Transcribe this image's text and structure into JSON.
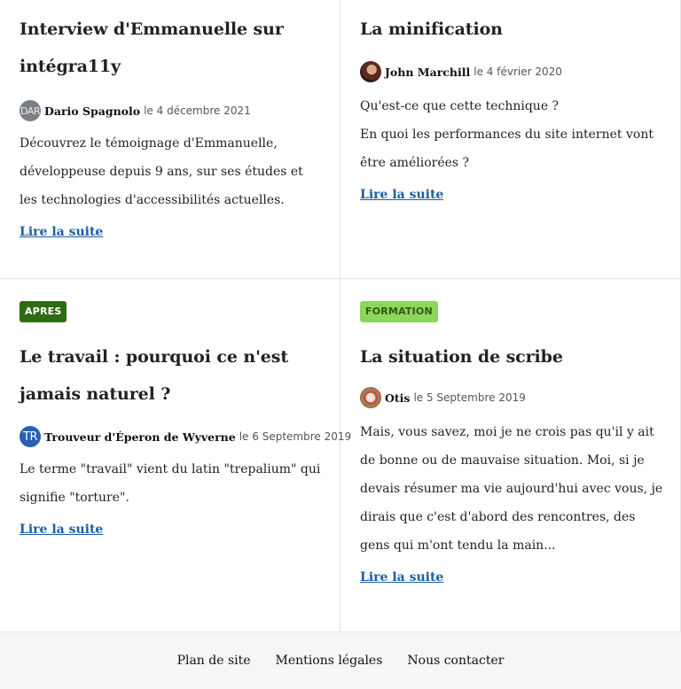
{
  "colors": {
    "link": "#1a5ea8",
    "badge_apres_bg": "#2e6b12",
    "badge_apres_text": "#ffffff",
    "badge_formation_bg": "#8ed65a",
    "badge_formation_text": "#2f5a14"
  },
  "articles": [
    {
      "title": "Interview d'Emmanuelle sur intégra11y",
      "author": "Dario Spagnolo",
      "avatar_text": "DAR",
      "date": "le 4 décembre 2021",
      "excerpt": "Découvrez le témoignage d'Emmanuelle, développeuse depuis 9 ans, sur ses études et les technologies d'accessibilités actuelles.",
      "read_more": "Lire la suite"
    },
    {
      "title": "La minification",
      "author": "John Marchill",
      "avatar_text": "",
      "date": "le 4 février 2020",
      "excerpt_lines": [
        "Qu'est-ce que cette technique ?",
        "En quoi les performances du site internet vont être améliorées ?"
      ],
      "read_more": "Lire la suite"
    },
    {
      "badge": "APRES",
      "title": "Le travail : pourquoi ce n'est jamais naturel ?",
      "author": "Trouveur d'Éperon de Wyverne",
      "avatar_text": "TR",
      "date": "le 6 Septembre 2019",
      "excerpt": "Le terme \"travail\" vient du latin \"trepalium\" qui signifie \"torture\".",
      "read_more": "Lire la suite"
    },
    {
      "badge": "FORMATION",
      "title": "La situation de scribe",
      "author": "Otis",
      "avatar_text": "",
      "date": "le 5 Septembre 2019",
      "excerpt": "Mais, vous savez, moi je ne crois pas qu'il y ait de bonne ou de mauvaise situation. Moi, si je devais résumer ma vie aujourd'hui avec vous, je dirais que c'est d'abord des rencontres, des gens qui m'ont tendu la main...",
      "read_more": "Lire la suite"
    }
  ],
  "footer": {
    "links": [
      "Plan de site",
      "Mentions légales",
      "Nous contacter"
    ]
  }
}
